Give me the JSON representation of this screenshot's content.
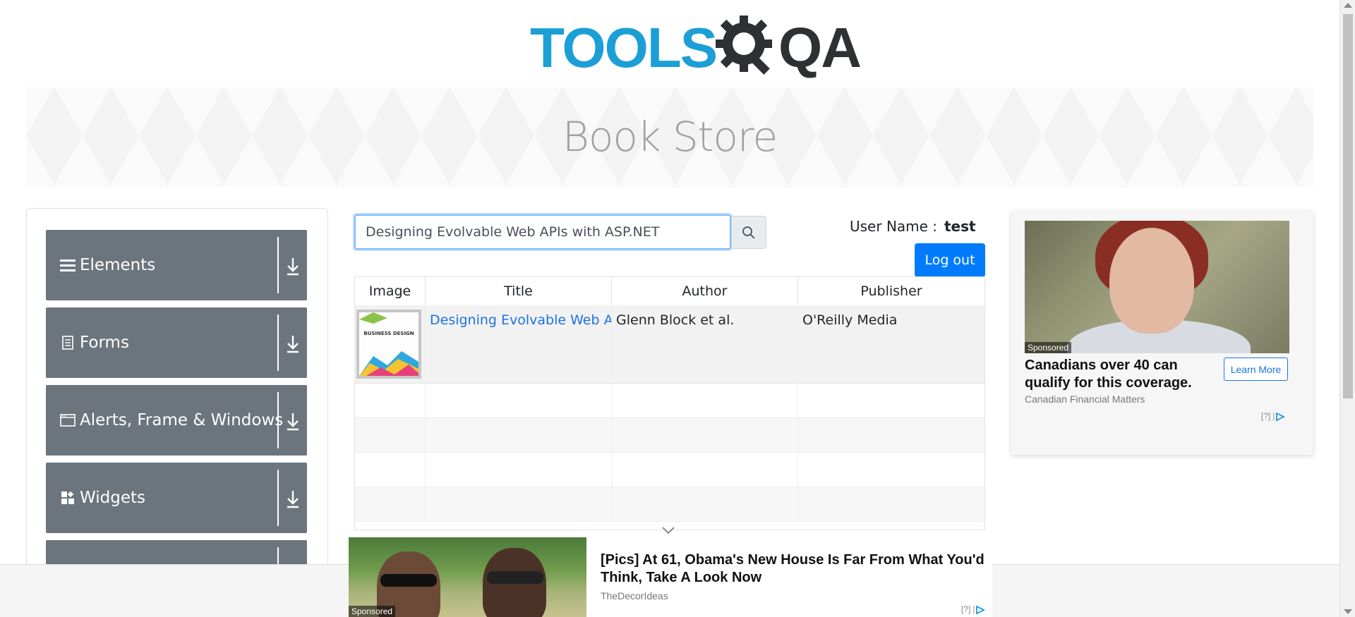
{
  "header": {
    "logo_tools": "TOOLS",
    "logo_qa": "QA"
  },
  "banner": {
    "title": "Book Store"
  },
  "sidebar": {
    "items": [
      {
        "label": "Elements",
        "icon": "hamburger-icon"
      },
      {
        "label": "Forms",
        "icon": "document-icon"
      },
      {
        "label": "Alerts, Frame & Windows",
        "icon": "window-icon"
      },
      {
        "label": "Widgets",
        "icon": "widgets-icon"
      },
      {
        "label": "",
        "icon": ""
      }
    ]
  },
  "search": {
    "value": "Designing Evolvable Web APIs with ASP.NET",
    "icon": "search-icon"
  },
  "user": {
    "label": "User Name :",
    "name": "test",
    "logout_label": "Log out"
  },
  "table": {
    "columns": [
      "Image",
      "Title",
      "Author",
      "Publisher"
    ],
    "rows": [
      {
        "title": "Designing Evolvable Web APIs with ASP.NET",
        "author": "Glenn Block et al.",
        "publisher": "O'Reilly Media",
        "cover_text": "BUSINESS DESIGN"
      }
    ]
  },
  "ad_right": {
    "sponsored": "Sponsored",
    "headline": "Canadians over 40 can qualify for this coverage.",
    "source": "Canadian Financial Matters",
    "cta": "Learn More",
    "info": "[?]"
  },
  "ad_bottom": {
    "sponsored": "Sponsored",
    "headline": "[Pics] At 61, Obama's New House Is Far From What You'd Think, Take A Look Now",
    "source": "TheDecorIdeas",
    "info": "[?]"
  },
  "colors": {
    "brand_blue": "#1b9fd6",
    "brand_dark": "#2f3034",
    "menu_bg": "#6c757d",
    "link": "#1a73e8",
    "button_primary": "#007bff"
  }
}
